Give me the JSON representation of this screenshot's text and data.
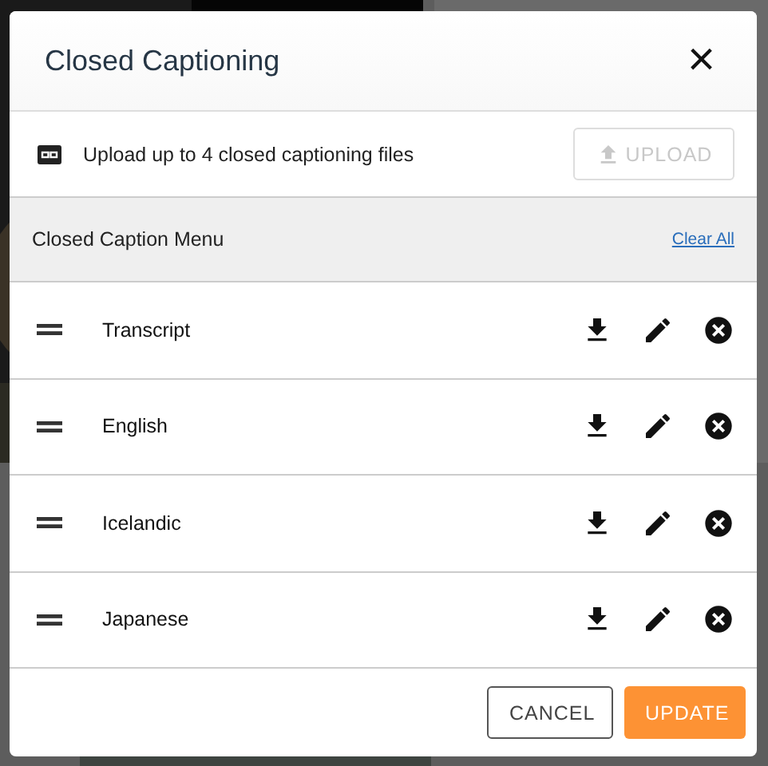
{
  "dialog": {
    "title": "Closed Captioning",
    "close_label": "×"
  },
  "upload": {
    "text": "Upload up to 4 closed captioning files",
    "button": "UPLOAD",
    "disabled": true
  },
  "menu": {
    "title": "Closed Caption Menu",
    "clear_link": "Clear All"
  },
  "captions": [
    {
      "name": "Transcript"
    },
    {
      "name": "English"
    },
    {
      "name": "Icelandic"
    },
    {
      "name": "Japanese"
    }
  ],
  "buttons": [
    {
      "label": "CANCEL",
      "kind": "secondary"
    },
    {
      "label": "UPDATE",
      "kind": "primary"
    }
  ]
}
